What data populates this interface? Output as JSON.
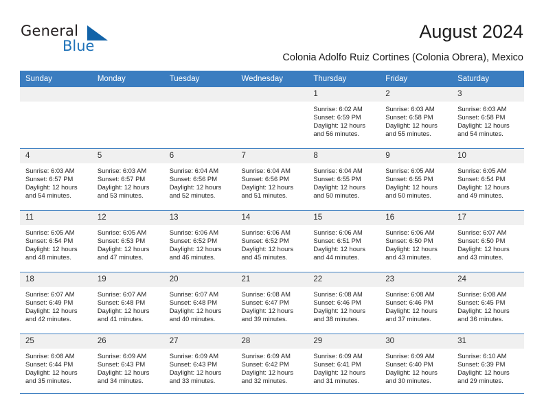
{
  "brand": {
    "name_part1": "General",
    "name_part2": "Blue",
    "accent_color": "#1263a8"
  },
  "header": {
    "title": "August 2024",
    "subtitle": "Colonia Adolfo Ruiz Cortines (Colonia Obrera), Mexico",
    "header_bg_color": "#3b7dc0"
  },
  "weekday_headers": [
    "Sunday",
    "Monday",
    "Tuesday",
    "Wednesday",
    "Thursday",
    "Friday",
    "Saturday"
  ],
  "weeks": [
    [
      {
        "day": "",
        "blank": true,
        "sunrise": "",
        "sunset": "",
        "daylight1": "",
        "daylight2": ""
      },
      {
        "day": "",
        "blank": true,
        "sunrise": "",
        "sunset": "",
        "daylight1": "",
        "daylight2": ""
      },
      {
        "day": "",
        "blank": true,
        "sunrise": "",
        "sunset": "",
        "daylight1": "",
        "daylight2": ""
      },
      {
        "day": "",
        "blank": true,
        "sunrise": "",
        "sunset": "",
        "daylight1": "",
        "daylight2": ""
      },
      {
        "day": "1",
        "blank": false,
        "sunrise": "Sunrise: 6:02 AM",
        "sunset": "Sunset: 6:59 PM",
        "daylight1": "Daylight: 12 hours",
        "daylight2": "and 56 minutes."
      },
      {
        "day": "2",
        "blank": false,
        "sunrise": "Sunrise: 6:03 AM",
        "sunset": "Sunset: 6:58 PM",
        "daylight1": "Daylight: 12 hours",
        "daylight2": "and 55 minutes."
      },
      {
        "day": "3",
        "blank": false,
        "sunrise": "Sunrise: 6:03 AM",
        "sunset": "Sunset: 6:58 PM",
        "daylight1": "Daylight: 12 hours",
        "daylight2": "and 54 minutes."
      }
    ],
    [
      {
        "day": "4",
        "blank": false,
        "sunrise": "Sunrise: 6:03 AM",
        "sunset": "Sunset: 6:57 PM",
        "daylight1": "Daylight: 12 hours",
        "daylight2": "and 54 minutes."
      },
      {
        "day": "5",
        "blank": false,
        "sunrise": "Sunrise: 6:03 AM",
        "sunset": "Sunset: 6:57 PM",
        "daylight1": "Daylight: 12 hours",
        "daylight2": "and 53 minutes."
      },
      {
        "day": "6",
        "blank": false,
        "sunrise": "Sunrise: 6:04 AM",
        "sunset": "Sunset: 6:56 PM",
        "daylight1": "Daylight: 12 hours",
        "daylight2": "and 52 minutes."
      },
      {
        "day": "7",
        "blank": false,
        "sunrise": "Sunrise: 6:04 AM",
        "sunset": "Sunset: 6:56 PM",
        "daylight1": "Daylight: 12 hours",
        "daylight2": "and 51 minutes."
      },
      {
        "day": "8",
        "blank": false,
        "sunrise": "Sunrise: 6:04 AM",
        "sunset": "Sunset: 6:55 PM",
        "daylight1": "Daylight: 12 hours",
        "daylight2": "and 50 minutes."
      },
      {
        "day": "9",
        "blank": false,
        "sunrise": "Sunrise: 6:05 AM",
        "sunset": "Sunset: 6:55 PM",
        "daylight1": "Daylight: 12 hours",
        "daylight2": "and 50 minutes."
      },
      {
        "day": "10",
        "blank": false,
        "sunrise": "Sunrise: 6:05 AM",
        "sunset": "Sunset: 6:54 PM",
        "daylight1": "Daylight: 12 hours",
        "daylight2": "and 49 minutes."
      }
    ],
    [
      {
        "day": "11",
        "blank": false,
        "sunrise": "Sunrise: 6:05 AM",
        "sunset": "Sunset: 6:54 PM",
        "daylight1": "Daylight: 12 hours",
        "daylight2": "and 48 minutes."
      },
      {
        "day": "12",
        "blank": false,
        "sunrise": "Sunrise: 6:05 AM",
        "sunset": "Sunset: 6:53 PM",
        "daylight1": "Daylight: 12 hours",
        "daylight2": "and 47 minutes."
      },
      {
        "day": "13",
        "blank": false,
        "sunrise": "Sunrise: 6:06 AM",
        "sunset": "Sunset: 6:52 PM",
        "daylight1": "Daylight: 12 hours",
        "daylight2": "and 46 minutes."
      },
      {
        "day": "14",
        "blank": false,
        "sunrise": "Sunrise: 6:06 AM",
        "sunset": "Sunset: 6:52 PM",
        "daylight1": "Daylight: 12 hours",
        "daylight2": "and 45 minutes."
      },
      {
        "day": "15",
        "blank": false,
        "sunrise": "Sunrise: 6:06 AM",
        "sunset": "Sunset: 6:51 PM",
        "daylight1": "Daylight: 12 hours",
        "daylight2": "and 44 minutes."
      },
      {
        "day": "16",
        "blank": false,
        "sunrise": "Sunrise: 6:06 AM",
        "sunset": "Sunset: 6:50 PM",
        "daylight1": "Daylight: 12 hours",
        "daylight2": "and 43 minutes."
      },
      {
        "day": "17",
        "blank": false,
        "sunrise": "Sunrise: 6:07 AM",
        "sunset": "Sunset: 6:50 PM",
        "daylight1": "Daylight: 12 hours",
        "daylight2": "and 43 minutes."
      }
    ],
    [
      {
        "day": "18",
        "blank": false,
        "sunrise": "Sunrise: 6:07 AM",
        "sunset": "Sunset: 6:49 PM",
        "daylight1": "Daylight: 12 hours",
        "daylight2": "and 42 minutes."
      },
      {
        "day": "19",
        "blank": false,
        "sunrise": "Sunrise: 6:07 AM",
        "sunset": "Sunset: 6:48 PM",
        "daylight1": "Daylight: 12 hours",
        "daylight2": "and 41 minutes."
      },
      {
        "day": "20",
        "blank": false,
        "sunrise": "Sunrise: 6:07 AM",
        "sunset": "Sunset: 6:48 PM",
        "daylight1": "Daylight: 12 hours",
        "daylight2": "and 40 minutes."
      },
      {
        "day": "21",
        "blank": false,
        "sunrise": "Sunrise: 6:08 AM",
        "sunset": "Sunset: 6:47 PM",
        "daylight1": "Daylight: 12 hours",
        "daylight2": "and 39 minutes."
      },
      {
        "day": "22",
        "blank": false,
        "sunrise": "Sunrise: 6:08 AM",
        "sunset": "Sunset: 6:46 PM",
        "daylight1": "Daylight: 12 hours",
        "daylight2": "and 38 minutes."
      },
      {
        "day": "23",
        "blank": false,
        "sunrise": "Sunrise: 6:08 AM",
        "sunset": "Sunset: 6:46 PM",
        "daylight1": "Daylight: 12 hours",
        "daylight2": "and 37 minutes."
      },
      {
        "day": "24",
        "blank": false,
        "sunrise": "Sunrise: 6:08 AM",
        "sunset": "Sunset: 6:45 PM",
        "daylight1": "Daylight: 12 hours",
        "daylight2": "and 36 minutes."
      }
    ],
    [
      {
        "day": "25",
        "blank": false,
        "sunrise": "Sunrise: 6:08 AM",
        "sunset": "Sunset: 6:44 PM",
        "daylight1": "Daylight: 12 hours",
        "daylight2": "and 35 minutes."
      },
      {
        "day": "26",
        "blank": false,
        "sunrise": "Sunrise: 6:09 AM",
        "sunset": "Sunset: 6:43 PM",
        "daylight1": "Daylight: 12 hours",
        "daylight2": "and 34 minutes."
      },
      {
        "day": "27",
        "blank": false,
        "sunrise": "Sunrise: 6:09 AM",
        "sunset": "Sunset: 6:43 PM",
        "daylight1": "Daylight: 12 hours",
        "daylight2": "and 33 minutes."
      },
      {
        "day": "28",
        "blank": false,
        "sunrise": "Sunrise: 6:09 AM",
        "sunset": "Sunset: 6:42 PM",
        "daylight1": "Daylight: 12 hours",
        "daylight2": "and 32 minutes."
      },
      {
        "day": "29",
        "blank": false,
        "sunrise": "Sunrise: 6:09 AM",
        "sunset": "Sunset: 6:41 PM",
        "daylight1": "Daylight: 12 hours",
        "daylight2": "and 31 minutes."
      },
      {
        "day": "30",
        "blank": false,
        "sunrise": "Sunrise: 6:09 AM",
        "sunset": "Sunset: 6:40 PM",
        "daylight1": "Daylight: 12 hours",
        "daylight2": "and 30 minutes."
      },
      {
        "day": "31",
        "blank": false,
        "sunrise": "Sunrise: 6:10 AM",
        "sunset": "Sunset: 6:39 PM",
        "daylight1": "Daylight: 12 hours",
        "daylight2": "and 29 minutes."
      }
    ]
  ]
}
